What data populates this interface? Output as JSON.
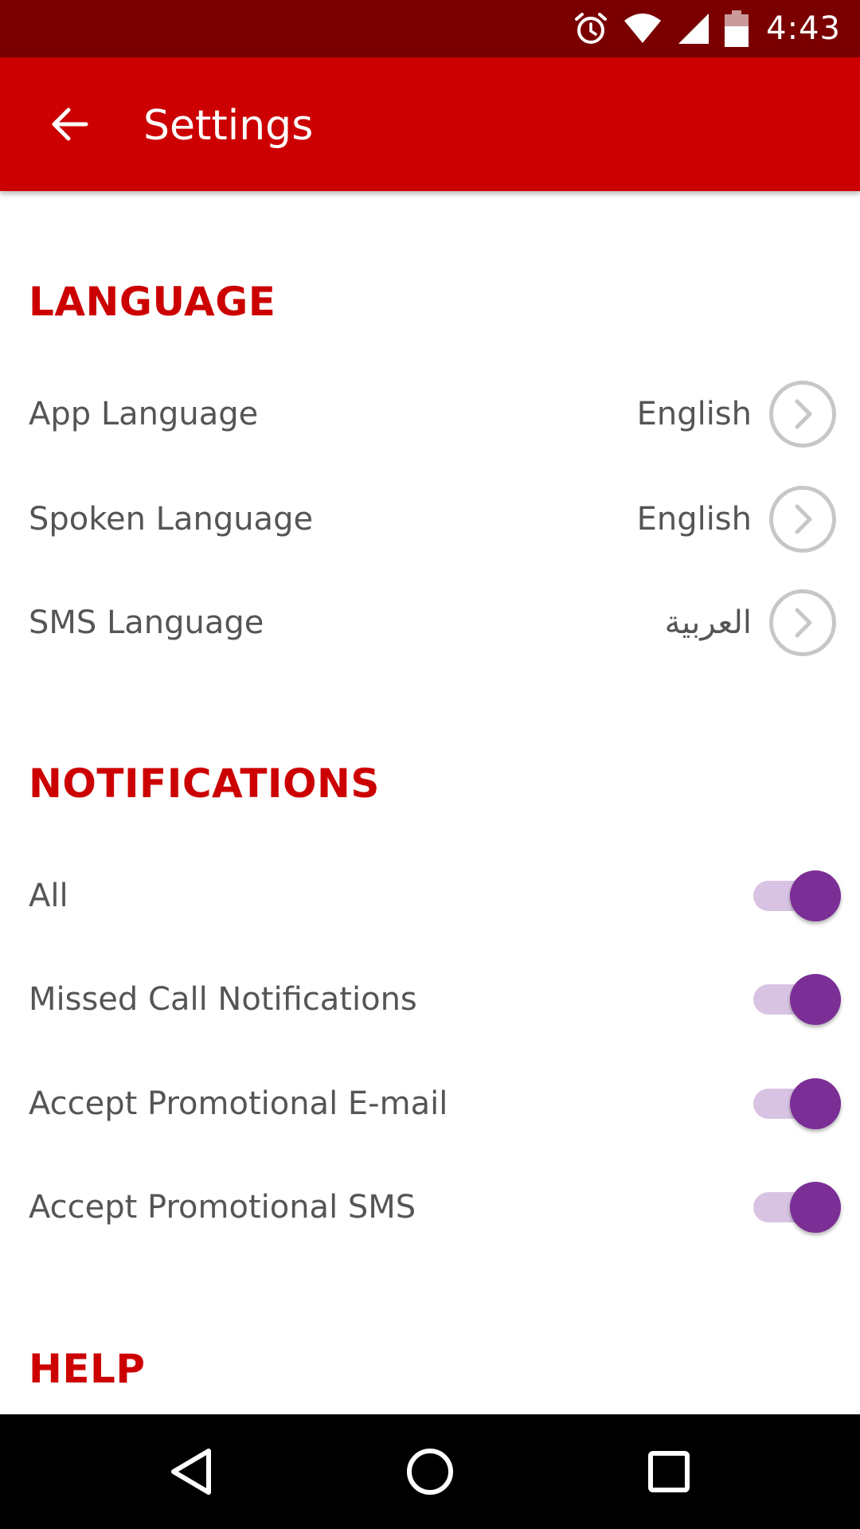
{
  "status_bar": {
    "time": "4:43",
    "icons": [
      "alarm-icon",
      "wifi-icon",
      "cellular-signal-icon",
      "battery-icon"
    ]
  },
  "app_bar": {
    "title": "Settings",
    "back_icon": "arrow-back-icon"
  },
  "sections": {
    "language": {
      "title": "LANGUAGE",
      "items": [
        {
          "label": "App Language",
          "value": "English"
        },
        {
          "label": "Spoken Language",
          "value": "English"
        },
        {
          "label": "SMS Language",
          "value": "العربية"
        }
      ]
    },
    "notifications": {
      "title": "NOTIFICATIONS",
      "items": [
        {
          "label": "All",
          "enabled": true
        },
        {
          "label": "Missed Call Notifications",
          "enabled": true
        },
        {
          "label": "Accept Promotional E-mail",
          "enabled": true
        },
        {
          "label": "Accept Promotional SMS",
          "enabled": true
        }
      ]
    },
    "help": {
      "title": "HELP"
    }
  },
  "nav_bar": {
    "buttons": [
      "back-triangle-icon",
      "home-circle-icon",
      "recents-square-icon"
    ]
  },
  "colors": {
    "status_bar": "#7a0000",
    "app_bar": "#cc0000",
    "section_title": "#cc0000",
    "toggle_thumb": "#7b2e96",
    "toggle_track": "#d8c3e3",
    "text": "#555555"
  }
}
